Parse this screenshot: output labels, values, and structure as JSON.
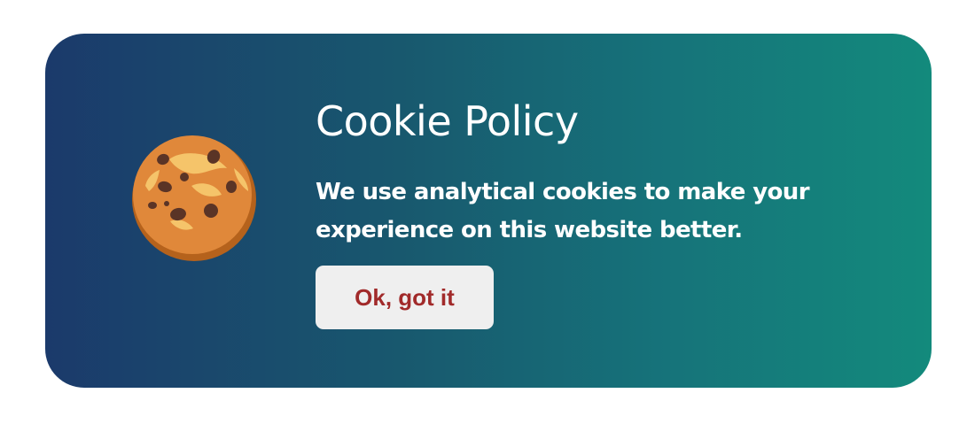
{
  "cookie_banner": {
    "icon": "cookie-icon",
    "title": "Cookie Policy",
    "message": "We use analytical cookies to make your experience on this website better.",
    "accept_label": "Ok, got it"
  },
  "colors": {
    "gradient_start": "#1b3a6b",
    "gradient_end": "#138a7c",
    "button_bg": "#efefef",
    "button_text": "#a12a2a",
    "text": "#ffffff"
  }
}
